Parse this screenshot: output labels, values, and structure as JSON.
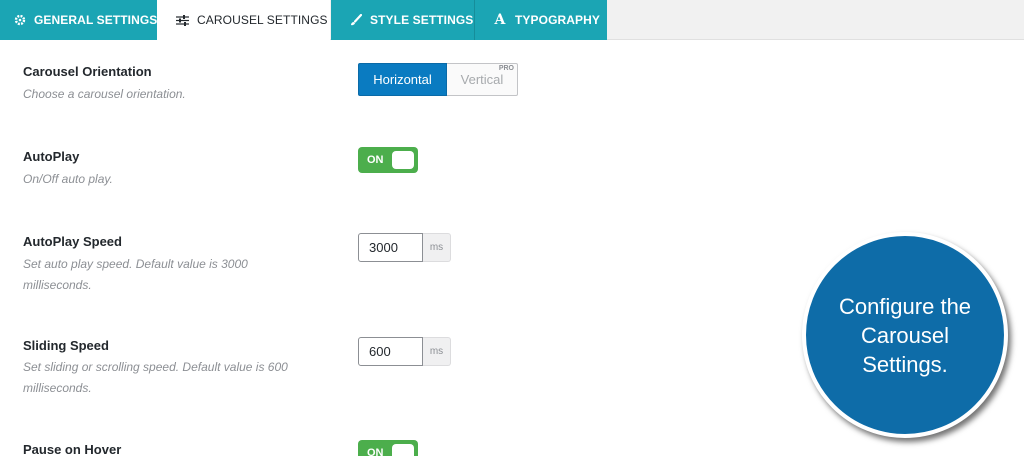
{
  "tabs": [
    {
      "label": "GENERAL SETTINGS",
      "icon": "gear-icon",
      "active": false
    },
    {
      "label": "CAROUSEL SETTINGS",
      "icon": "sliders-icon",
      "active": true
    },
    {
      "label": "STYLE SETTINGS",
      "icon": "brush-icon",
      "active": false
    },
    {
      "label": "TYPOGRAPHY",
      "icon": "typography-icon",
      "active": false
    }
  ],
  "settings": {
    "orientation": {
      "label": "Carousel Orientation",
      "desc": "Choose a carousel orientation.",
      "options": {
        "horizontal": "Horizontal",
        "vertical": "Vertical",
        "pro_badge": "PRO"
      },
      "selected": "Horizontal"
    },
    "autoplay": {
      "label": "AutoPlay",
      "desc": "On/Off auto play.",
      "state": "ON"
    },
    "autoplay_speed": {
      "label": "AutoPlay Speed",
      "desc": "Set auto play speed. Default value is 3000 milliseconds.",
      "value": "3000",
      "unit": "ms"
    },
    "sliding_speed": {
      "label": "Sliding Speed",
      "desc": "Set sliding or scrolling speed. Default value is 600 milliseconds.",
      "value": "600",
      "unit": "ms"
    },
    "pause_on_hover": {
      "label": "Pause on Hover",
      "state": "ON"
    }
  },
  "callout": {
    "text": "Configure the Carousel Settings."
  },
  "colors": {
    "tab_bg": "#1ba5b4",
    "primary_blue": "#0a7bc1",
    "toggle_green": "#4cae4c",
    "callout_blue": "#0e6ca8"
  }
}
